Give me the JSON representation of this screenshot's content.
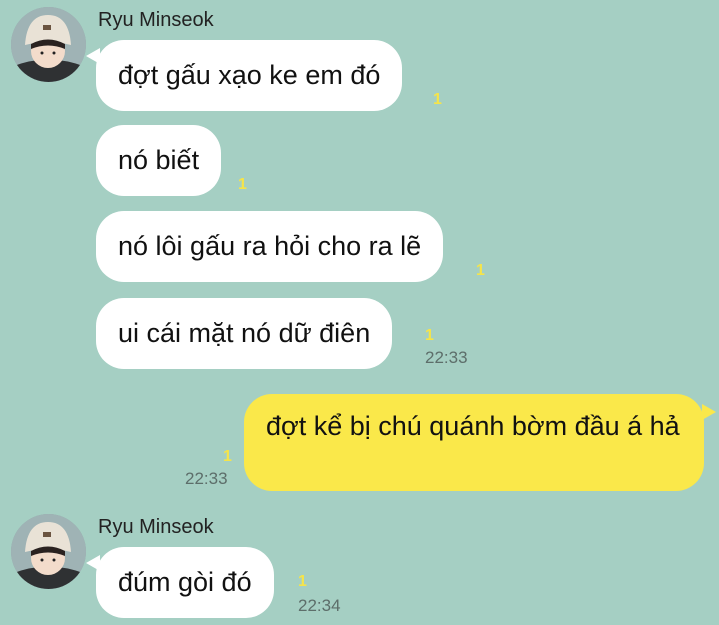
{
  "colors": {
    "background": "#a5cfc3",
    "incoming_bubble": "#ffffff",
    "outgoing_bubble": "#fae84a",
    "unread_count": "#f5e44a",
    "timestamp": "#5d6e6a"
  },
  "groups": [
    {
      "sender": "Ryu Minseok",
      "avatar_icon": "profile-photo-bucket-hat",
      "messages": [
        {
          "text": "đợt gấu xạo ke em đó",
          "unread": "1",
          "time": ""
        },
        {
          "text": "nó biết",
          "unread": "1",
          "time": ""
        },
        {
          "text": "nó lôi gấu ra hỏi cho ra lẽ",
          "unread": "1",
          "time": ""
        },
        {
          "text": "ui cái mặt nó dữ điên",
          "unread": "1",
          "time": "22:33"
        }
      ]
    },
    {
      "sender": "Ryu Minseok",
      "avatar_icon": "profile-photo-bucket-hat",
      "messages": [
        {
          "text": "đúm gòi đó",
          "unread": "1",
          "time": "22:34"
        }
      ]
    }
  ],
  "outgoing": [
    {
      "text": "đợt kể bị chú quánh bờm đầu á hả",
      "unread": "1",
      "time": "22:33"
    }
  ]
}
